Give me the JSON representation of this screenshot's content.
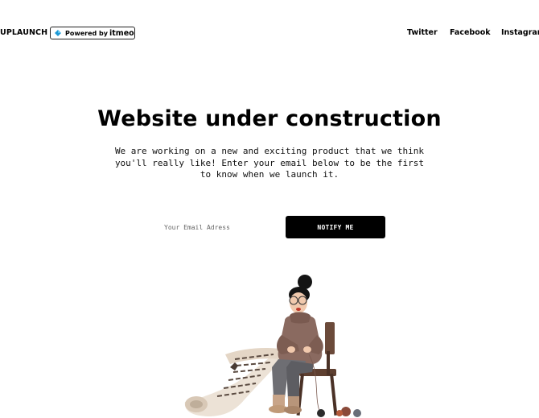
{
  "header": {
    "brand": "UPLAUNCH",
    "powered_prefix": "Powered by",
    "powered_brand": "itmeo",
    "nav": [
      "Twitter",
      "Facebook",
      "Instagram"
    ]
  },
  "hero": {
    "title": "Website under construction",
    "subtitle_lines": [
      "We are working on a new and exciting product that we think",
      "you'll really like! Enter your email below to be the first",
      "to know when we launch it."
    ]
  },
  "signup": {
    "placeholder": "Your Email Adress",
    "button_label": "NOTIFY ME"
  },
  "colors": {
    "background": "#ffffff",
    "text": "#000000",
    "button": "#000000",
    "logo_diamond": "#1e9ad6"
  },
  "icons": {
    "powered_logo": "diamond-logo-icon",
    "illustration": "woman-knitting-illustration"
  }
}
